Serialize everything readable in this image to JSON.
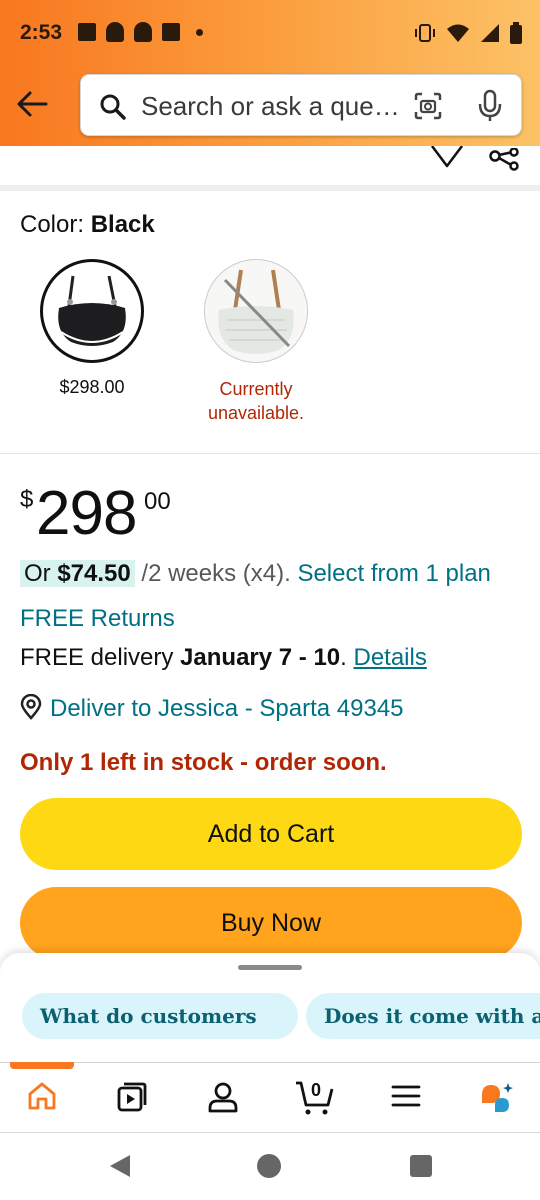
{
  "status_bar": {
    "time": "2:53"
  },
  "search": {
    "placeholder": "Search or ask a que…"
  },
  "color_selector": {
    "label": "Color: ",
    "selected": "Black",
    "options": [
      {
        "name": "Black",
        "price": "$298.00"
      },
      {
        "name": "White",
        "status": "Currently unavailable."
      }
    ]
  },
  "price": {
    "currency": "$",
    "whole": "298",
    "fraction": "00"
  },
  "installment": {
    "prefix": "Or ",
    "amount": "$74.50",
    "terms": " /2 weeks (x4). ",
    "link": "Select from 1 plan"
  },
  "returns": "FREE Returns",
  "delivery": {
    "prefix": "FREE delivery ",
    "dates": "January 7 - 10",
    "sep": ". ",
    "details": "Details"
  },
  "deliver_to": "Deliver to Jessica - Sparta 49345",
  "stock": "Only 1 left in stock - order soon.",
  "buttons": {
    "add_to_cart": "Add to Cart",
    "buy_now": "Buy Now"
  },
  "suggestions": [
    "What do customers",
    "Does it come with a d"
  ],
  "bottom_nav": {
    "items": [
      "home-icon",
      "video-icon",
      "account-icon",
      "cart-icon",
      "menu-icon",
      "rufus-icon"
    ],
    "cart_count": "0",
    "active": "home"
  },
  "colors": {
    "header_start": "#f8771f",
    "cart_btn": "#ffd814",
    "buy_btn": "#ffa41c",
    "link": "#007185",
    "alert": "#b12704"
  }
}
